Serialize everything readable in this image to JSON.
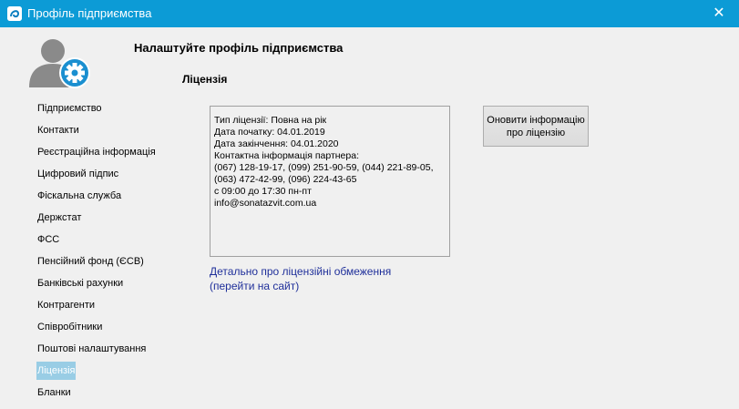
{
  "window": {
    "title": "Профіль підприємства",
    "close_glyph": "✕"
  },
  "header": {
    "title": "Налаштуйте профіль підприємства",
    "section_title": "Ліцензія"
  },
  "sidebar": {
    "items": [
      {
        "label": "Підприємство"
      },
      {
        "label": "Контакти"
      },
      {
        "label": "Реєстраційна інформація"
      },
      {
        "label": "Цифровий підпис"
      },
      {
        "label": "Фіскальна служба"
      },
      {
        "label": "Держстат"
      },
      {
        "label": "ФСС"
      },
      {
        "label": "Пенсійний фонд (ЄСВ)"
      },
      {
        "label": "Банківські рахунки"
      },
      {
        "label": "Контрагенти"
      },
      {
        "label": "Співробітники"
      },
      {
        "label": "Поштові налаштування"
      },
      {
        "label": "Ліцензія",
        "active": true
      },
      {
        "label": "Бланки"
      }
    ]
  },
  "license": {
    "lines": [
      "Тип ліцензії: Повна на рік",
      "Дата початку: 04.01.2019",
      "Дата закінчення: 04.01.2020",
      "Контактна інформація партнера:",
      "(067) 128-19-17, (099) 251-90-59, (044) 221-89-05,",
      "(063) 472-42-99, (096) 224-43-65",
      "с 09:00 до 17:30 пн-пт",
      "info@sonatazvit.com.ua"
    ],
    "update_button_line1": "Оновити інформацію",
    "update_button_line2": "про ліцензію",
    "link_line1": "Детально про ліцензійні обмеження",
    "link_line2": "(перейти на сайт)"
  },
  "colors": {
    "titlebar": "#0c9bd6",
    "active_item_bg": "#99cde5",
    "link": "#1f2f9a",
    "avatar_gray": "#8a8a8a",
    "gear_blue": "#1a8fd0"
  },
  "icons": {
    "app": "app-logo-icon",
    "close": "close-icon",
    "avatar": "user-settings-icon"
  }
}
